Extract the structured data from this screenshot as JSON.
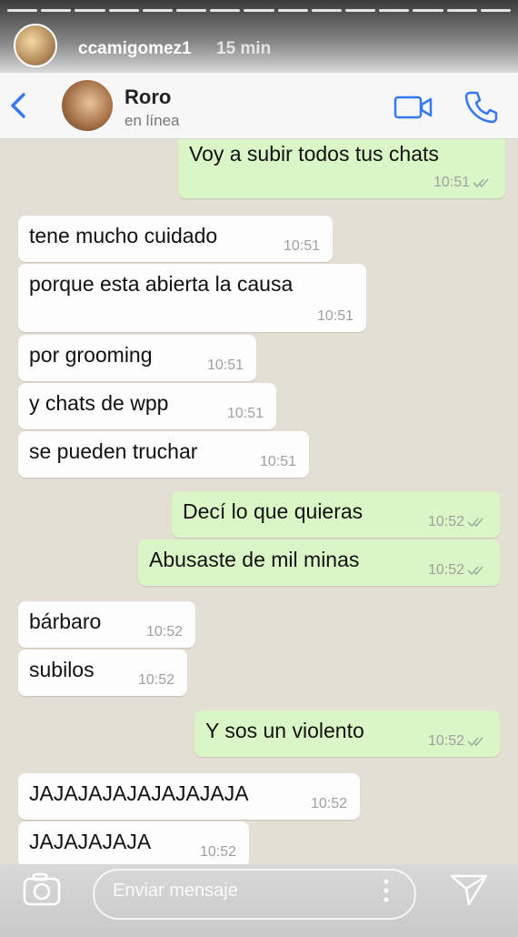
{
  "story": {
    "username": "ccamigomez1",
    "time_ago": "15 min",
    "segments": 15
  },
  "header": {
    "contact_name": "Roro",
    "status": "en línea"
  },
  "messages": [
    {
      "dir": "out",
      "text": "Voy a subir todos tus chats",
      "time": "10:51"
    },
    {
      "dir": "in",
      "text": "tene mucho cuidado",
      "time": "10:51"
    },
    {
      "dir": "in",
      "text": "porque esta abierta la causa",
      "time": "10:51"
    },
    {
      "dir": "in",
      "text": "por grooming",
      "time": "10:51"
    },
    {
      "dir": "in",
      "text": "y chats de wpp",
      "time": "10:51"
    },
    {
      "dir": "in",
      "text": "se pueden truchar",
      "time": "10:51"
    },
    {
      "dir": "out",
      "text": "Decí lo que quieras",
      "time": "10:52"
    },
    {
      "dir": "out",
      "text": "Abusaste de mil minas",
      "time": "10:52"
    },
    {
      "dir": "in",
      "text": "bárbaro",
      "time": "10:52"
    },
    {
      "dir": "in",
      "text": "subilos",
      "time": "10:52"
    },
    {
      "dir": "out",
      "text": "Y sos un violento",
      "time": "10:52"
    },
    {
      "dir": "in",
      "text": "JAJAJAJAJAJAJAJAJA",
      "time": "10:52"
    },
    {
      "dir": "in",
      "text": "JAJAJAJAJA",
      "time": "10:52"
    }
  ],
  "input": {
    "placeholder": "Enviar mensaje"
  },
  "colors": {
    "incoming": "#fdfdfd",
    "outgoing": "#dbf6c6",
    "accent": "#3478f6"
  },
  "icons": {
    "back": "chevron-left-icon",
    "video": "video-call-icon",
    "phone": "phone-icon",
    "camera": "camera-icon",
    "more": "more-vertical-icon",
    "send": "send-icon"
  }
}
